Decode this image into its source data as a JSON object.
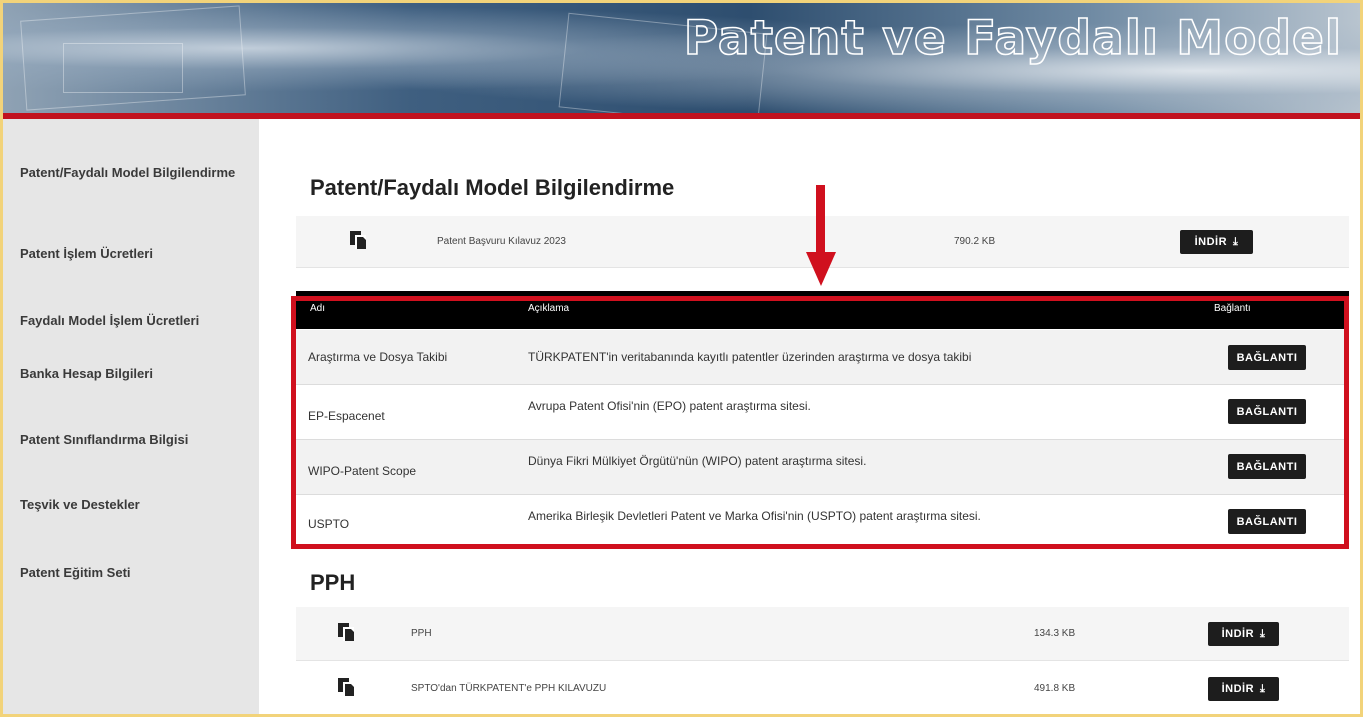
{
  "banner": {
    "title": "Patent ve Faydalı Model"
  },
  "sidebar": {
    "items": [
      {
        "label": "Patent/Faydalı Model Bilgilendirme"
      },
      {
        "label": "Patent İşlem Ücretleri"
      },
      {
        "label": "Faydalı Model İşlem Ücretleri"
      },
      {
        "label": "Banka Hesap Bilgileri"
      },
      {
        "label": "Patent Sınıflandırma Bilgisi"
      },
      {
        "label": "Teşvik ve Destekler"
      },
      {
        "label": "Patent Eğitim Seti"
      }
    ]
  },
  "section1": {
    "title": "Patent/Faydalı Model Bilgilendirme",
    "files": [
      {
        "name": "Patent Başvuru Kılavuz 2023",
        "size": "790.2 KB",
        "button": "İNDİR"
      }
    ]
  },
  "table": {
    "headers": {
      "name": "Adı",
      "desc": "Açıklama",
      "link": "Bağlantı"
    },
    "rows": [
      {
        "name": "Araştırma ve Dosya Takibi",
        "desc": "TÜRKPATENT'in veritabanında kayıtlı patentler üzerinden araştırma ve dosya takibi",
        "button": "BAĞLANTI"
      },
      {
        "name": "EP-Espacenet",
        "desc": "Avrupa Patent Ofisi'nin (EPO) patent araştırma sitesi.",
        "button": "BAĞLANTI"
      },
      {
        "name": "WIPO-Patent Scope",
        "desc": "Dünya Fikri Mülkiyet Örgütü'nün (WIPO) patent araştırma sitesi.",
        "button": "BAĞLANTI"
      },
      {
        "name": "USPTO",
        "desc": "Amerika Birleşik Devletleri Patent ve Marka Ofisi'nin (USPTO) patent araştırma sitesi.",
        "button": "BAĞLANTI"
      }
    ]
  },
  "section2": {
    "title": "PPH",
    "files": [
      {
        "name": "PPH",
        "size": "134.3 KB",
        "button": "İNDİR"
      },
      {
        "name": "SPTO'dan TÜRKPATENT'e PPH KILAVUZU",
        "size": "491.8 KB",
        "button": "İNDİR"
      }
    ]
  },
  "colors": {
    "accent": "#d0101e",
    "banner_line": "#c1121f",
    "button": "#1d1d1d",
    "sidebar_bg": "#e6e6e6"
  },
  "icons": {
    "file": "file-copy-icon",
    "download": "download-icon",
    "arrow": "arrow-down-icon"
  }
}
